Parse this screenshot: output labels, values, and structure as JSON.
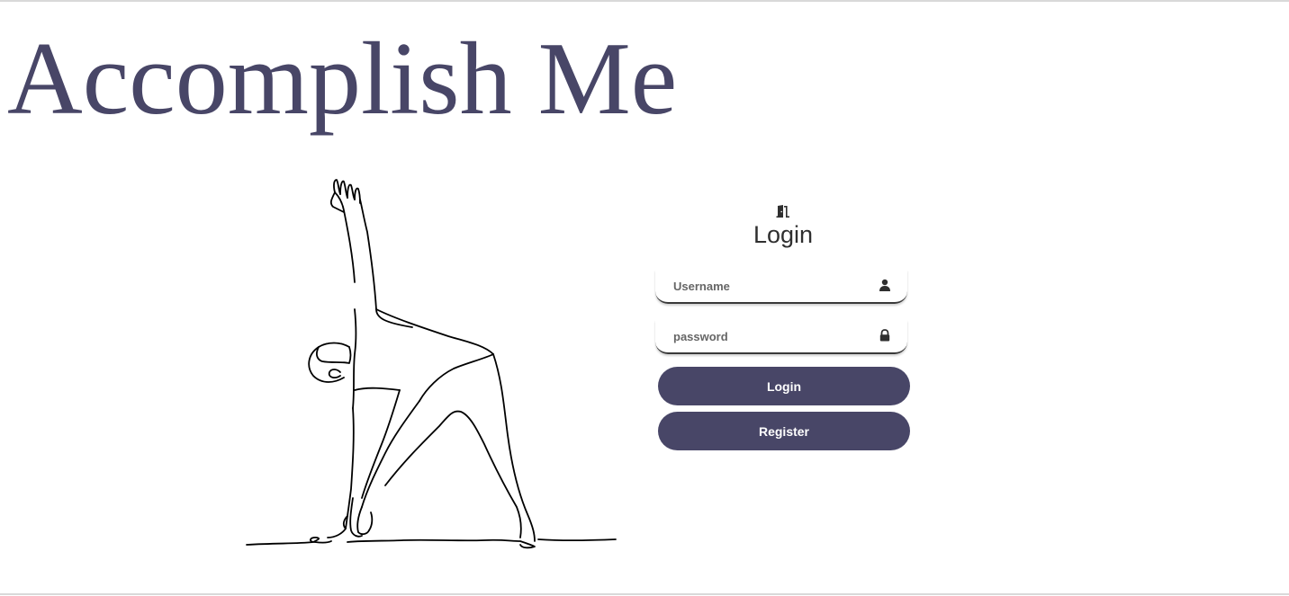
{
  "header": {
    "title": "Accomplish Me"
  },
  "illustration": {
    "icon": "yoga-line-art-illustration"
  },
  "login": {
    "icon": "door-icon",
    "heading": "Login",
    "username": {
      "placeholder": "Username",
      "value": "",
      "icon": "user-icon"
    },
    "password": {
      "placeholder": "password",
      "value": "",
      "icon": "lock-icon"
    },
    "login_label": "Login",
    "register_label": "Register"
  },
  "colors": {
    "brand": "#484667",
    "text": "#2f2f2f",
    "background": "#ffffff"
  }
}
